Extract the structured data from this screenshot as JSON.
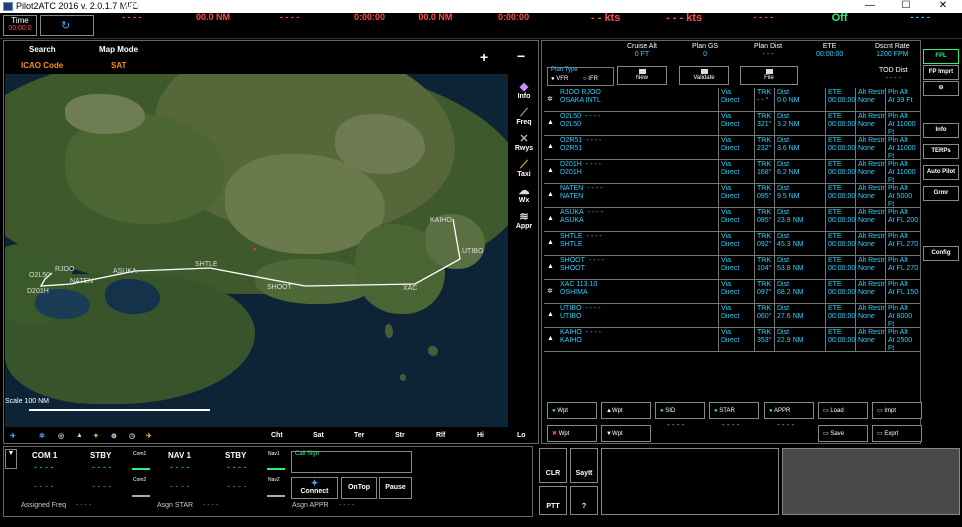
{
  "window": {
    "title": "Pilot2ATC 2016 v. 2.0.1.7 MFD",
    "min": "—",
    "max": "☐",
    "close": "✕"
  },
  "topbar": {
    "time_label": "Time",
    "time_value": "00:00:0",
    "cols": [
      {
        "h": "WPT",
        "v": "- - - -"
      },
      {
        "h": "DST",
        "v": "00.0 NM"
      },
      {
        "h": "DTK",
        "v": "- - - -"
      },
      {
        "h": "ETE",
        "v": "0:00:00"
      },
      {
        "h": "Dest Dist",
        "v": "00.0 NM"
      },
      {
        "h": "Dest ETE",
        "v": "0:00:00"
      },
      {
        "h": "TAS",
        "v": "- - kts"
      },
      {
        "h": "GS",
        "v": "- - - kts"
      },
      {
        "h": "Altimeter",
        "v": "- - - -"
      },
      {
        "h": "Ident",
        "v": "Off"
      },
      {
        "h": "XPDR",
        "v": "- - - -"
      }
    ]
  },
  "map": {
    "search": "Search",
    "map_mode": "Map Mode",
    "icao": "ICAO Code",
    "sat": "SAT",
    "plus": "+",
    "minus": "−",
    "tools": [
      "Info",
      "Freq",
      "Rwys",
      "Taxi",
      "Wx",
      "Appr"
    ],
    "bottom": [
      "Cht",
      "Sat",
      "Ter",
      "Str",
      "Rlf",
      "Hi",
      "Lo"
    ],
    "scale": "Scale 100 NM",
    "labels": [
      "RJOO",
      "O2L50",
      "D201H",
      "NATEN",
      "ASUKA",
      "SHTLE",
      "SHOOT",
      "XAC",
      "UTIBO",
      "KAIHO"
    ]
  },
  "fpl": {
    "cruise_alt_h": "Cruise Alt",
    "cruise_alt_v": "0 FT",
    "plan_gs_h": "Plan GS",
    "plan_gs_v": "0",
    "plan_dist_h": "Plan Dist",
    "plan_dist_v": "- - -",
    "ete_h": "ETE",
    "ete_v": "00:00:00",
    "dscnt_h": "Dscnt Rate",
    "dscnt_v": "1200 FPM",
    "tod_h": "TOD Dist",
    "tod_v": "- - - -",
    "plan_type": "Plan Type",
    "vfr": "VFR",
    "ifr": "IFR",
    "new": "New",
    "validate": "Validate",
    "file": "File",
    "rows": [
      {
        "ic": "✲",
        "n1": "RJOO  RJOO",
        "n2": "OSAKA INTL",
        "via": "Via",
        "dir": "Direct",
        "trk": "TRK",
        "trkv": "- - °",
        "dist": "Dist",
        "distv": "0.0 NM",
        "ete": "ETE",
        "etev": "00:00:00",
        "alt": "Alt Restr",
        "altv": "None",
        "pln": "Pln Alt",
        "plnv": "At 39 Ft"
      },
      {
        "ic": "▲",
        "n1": "O2L50",
        "d": "- - - -",
        "n2": "O2L50",
        "via": "Via",
        "dir": "Direct",
        "trk": "TRK",
        "trkv": "321°",
        "dist": "Dist",
        "distv": "3.2 NM",
        "ete": "ETE",
        "etev": "00:00:00",
        "alt": "Alt Restr",
        "altv": "None",
        "pln": "Pln Alt",
        "plnv": "At 11000 Ft"
      },
      {
        "ic": "▲",
        "n1": "O2R51",
        "d": "- - - -",
        "n2": "O2R51",
        "via": "Via",
        "dir": "Direct",
        "trk": "TRK",
        "trkv": "232°",
        "dist": "Dist",
        "distv": "3.6 NM",
        "ete": "ETE",
        "etev": "00:00:00",
        "alt": "Alt Restr",
        "altv": "None",
        "pln": "Pln Alt",
        "plnv": "At 11000 Ft"
      },
      {
        "ic": "▲",
        "n1": "D201H",
        "d": "- - - -",
        "n2": "D201H",
        "via": "Via",
        "dir": "Direct",
        "trk": "TRK",
        "trkv": "168°",
        "dist": "Dist",
        "distv": "6.2 NM",
        "ete": "ETE",
        "etev": "00:00:00",
        "alt": "Alt Restr",
        "altv": "None",
        "pln": "Pln Alt",
        "plnv": "At 11000 Ft"
      },
      {
        "ic": "▲",
        "n1": "NATEN",
        "d": "- - - -",
        "n2": "NATEN",
        "via": "Via",
        "dir": "Direct",
        "trk": "TRK",
        "trkv": "095°",
        "dist": "Dist",
        "distv": "9.5 NM",
        "ete": "ETE",
        "etev": "00:00:00",
        "alt": "Alt Restr",
        "altv": "None",
        "pln": "Pln Alt",
        "plnv": "At 5000 Ft"
      },
      {
        "ic": "▲",
        "n1": "ASUKA",
        "d": "- - - -",
        "n2": "ASUKA",
        "via": "Via",
        "dir": "Direct",
        "trk": "TRK",
        "trkv": "085°",
        "dist": "Dist",
        "distv": "23.9 NM",
        "ete": "ETE",
        "etev": "00:00:00",
        "alt": "Alt Restr",
        "altv": "None",
        "pln": "Pln Alt",
        "plnv": "At FL 200"
      },
      {
        "ic": "▲",
        "n1": "SHTLE",
        "d": "- - - -",
        "n2": "SHTLE",
        "via": "Via",
        "dir": "Direct",
        "trk": "TRK",
        "trkv": "092°",
        "dist": "Dist",
        "distv": "45.3 NM",
        "ete": "ETE",
        "etev": "00:00:00",
        "alt": "Alt Restr",
        "altv": "None",
        "pln": "Pln Alt",
        "plnv": "At FL 270"
      },
      {
        "ic": "▲",
        "n1": "SHOOT",
        "d": "- - - -",
        "n2": "SHOOT",
        "via": "Via",
        "dir": "Direct",
        "trk": "TRK",
        "trkv": "104°",
        "dist": "Dist",
        "distv": "53.8 NM",
        "ete": "ETE",
        "etev": "00:00:00",
        "alt": "Alt Restr",
        "altv": "None",
        "pln": "Pln Alt",
        "plnv": "At FL 270"
      },
      {
        "ic": "✲",
        "n1": "XAC  113.10",
        "n2": "OSHIMA",
        "via": "Via",
        "dir": "Direct",
        "trk": "TRK",
        "trkv": "097°",
        "dist": "Dist",
        "distv": "68.2 NM",
        "ete": "ETE",
        "etev": "00:00:00",
        "alt": "Alt Restr",
        "altv": "None",
        "pln": "Pln Alt",
        "plnv": "At FL 150"
      },
      {
        "ic": "▲",
        "n1": "UTIBO",
        "d": "- - - -",
        "n2": "UTIBO",
        "via": "Via",
        "dir": "Direct",
        "trk": "TRK",
        "trkv": "060°",
        "dist": "Dist",
        "distv": "27.6 NM",
        "ete": "ETE",
        "etev": "00:00:00",
        "alt": "Alt Restr",
        "altv": "None",
        "pln": "Pln Alt",
        "plnv": "At 8000 Ft"
      },
      {
        "ic": "▲",
        "n1": "KAIHO",
        "d": "- - - -",
        "n2": "KAIHO",
        "via": "Via",
        "dir": "Direct",
        "trk": "TRK",
        "trkv": "353°",
        "dist": "Dist",
        "distv": "22.9 NM",
        "ete": "ETE",
        "etev": "00:00:00",
        "alt": "Alt Restr",
        "altv": "None",
        "pln": "Pln Alt",
        "plnv": "At 2500 Ft"
      }
    ],
    "btn_wpt": "Wpt",
    "btn_wpt2": "Wpt",
    "btn_sid": "SID",
    "btn_star": "STAR",
    "btn_appr": "APPR",
    "btn_load": "Load",
    "btn_impt": "Impt",
    "btn_delwpt": "Wpt",
    "btn_downwpt": "Wpt",
    "btn_save": "Save",
    "btn_exprt": "Exprt",
    "dash": "- - - -"
  },
  "right": [
    "FPL",
    "FP Imprt",
    "Info",
    "TERPs",
    "Auto Pilot",
    "Grmr",
    "Config"
  ],
  "radio": {
    "com1": "COM 1",
    "stby1": "STBY",
    "nav1": "NAV 1",
    "stby2": "STBY",
    "com1v": "- - - -",
    "stby1v": "- - - -",
    "nav1v": "- - - -",
    "stby2v": "- - - -",
    "com1_small": "Com1",
    "com2_small": "Com2",
    "nav1_small": "Nav1",
    "nav2_small": "Nav2",
    "com2v": "- - - -",
    "stbyc2": "- - - -",
    "nav2v": "- - - -",
    "stbyn2": "- - - -",
    "callsign": "Call Sign",
    "connect": "Connect",
    "ontop": "OnTop",
    "pause": "Pause",
    "assigned_freq": "Assigned Freq",
    "assigned_freq_v": "- - - -",
    "asgn_star": "Asgn STAR",
    "asgn_star_v": "- - - -",
    "asgn_appr": "Asgn APPR",
    "asgn_appr_v": "- - - -"
  },
  "bottom": {
    "clr": "CLR",
    "sayit": "SayIt",
    "ptt": "PTT",
    "q": "?"
  }
}
